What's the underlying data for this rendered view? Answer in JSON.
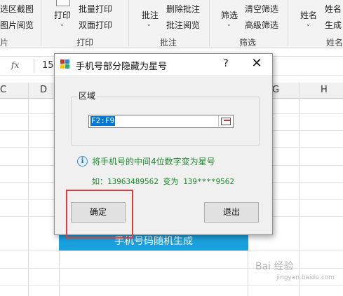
{
  "ribbon": {
    "left_items": [
      "选区截图",
      "图片阅览",
      "片"
    ],
    "print_label": "打印",
    "print_items": [
      "批量打印",
      "双面打印"
    ],
    "print_group": "打印",
    "comment_label": "批注",
    "comment_items": [
      "删除批注",
      "批注阅览"
    ],
    "comment_group": "批注",
    "filter_label": "筛选",
    "filter_items": [
      "清空筛选",
      "高级筛选"
    ],
    "filter_group": "筛选",
    "name_label": "姓名",
    "name_items": [
      "姓名",
      "生成"
    ],
    "name_group": "姓名"
  },
  "formula_bar": {
    "fx_label": "fx",
    "value": "15"
  },
  "columns": [
    "C",
    "D",
    "G",
    "H"
  ],
  "cell_banner": "手机号码随机生成",
  "dialog": {
    "title": "手机号部分隐藏为星号",
    "help": "?",
    "close": "✕",
    "group_label": "区域",
    "range_value": "F2:F9",
    "info_icon": "i",
    "info_text": "将手机号的中间4位数字变为星号",
    "example": "如：13963489562 变为 139****9562",
    "ok_label": "确定",
    "exit_label": "退出"
  },
  "watermark": {
    "text": "Bai 经验",
    "sub": "jingyan.baidu.com"
  },
  "colors": {
    "highlight": "#e23b3b",
    "banner": "#1aa1dd",
    "info_text": "#1e8a2e",
    "selection": "#0078d7"
  }
}
